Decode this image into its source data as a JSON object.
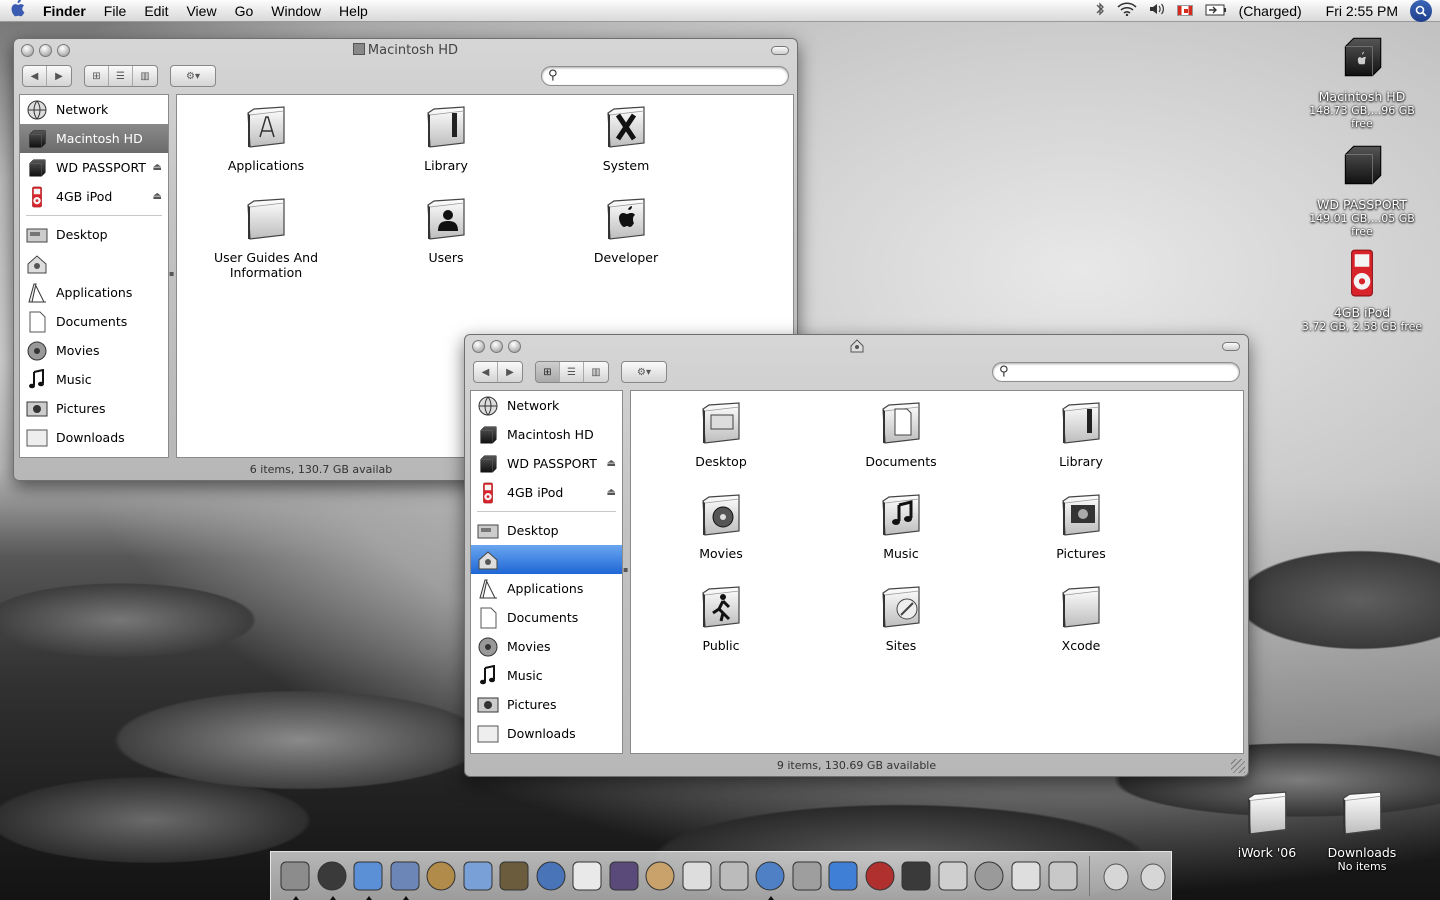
{
  "menubar": {
    "apple": "",
    "app_name": "Finder",
    "items": [
      "File",
      "Edit",
      "View",
      "Go",
      "Window",
      "Help"
    ],
    "battery_status": "(Charged)",
    "clock": "Fri 2:55 PM"
  },
  "window1": {
    "title": "Macintosh HD",
    "status": "6 items, 130.7 GB availab",
    "sidebar_devices": [
      {
        "label": "Network",
        "icon": "network-icon"
      },
      {
        "label": "Macintosh HD",
        "icon": "hard-drive-icon",
        "selected": true
      },
      {
        "label": "WD PASSPORT",
        "icon": "external-drive-icon",
        "eject": "⏏"
      },
      {
        "label": "4GB iPod",
        "icon": "ipod-icon",
        "eject": "⏏"
      }
    ],
    "sidebar_places": [
      {
        "label": "Desktop",
        "icon": "desktop-icon"
      },
      {
        "label": "",
        "icon": "home-icon"
      },
      {
        "label": "Applications",
        "icon": "applications-icon"
      },
      {
        "label": "Documents",
        "icon": "documents-icon"
      },
      {
        "label": "Movies",
        "icon": "movies-icon"
      },
      {
        "label": "Music",
        "icon": "music-icon"
      },
      {
        "label": "Pictures",
        "icon": "pictures-icon"
      },
      {
        "label": "Downloads",
        "icon": "downloads-icon"
      }
    ],
    "items": [
      {
        "label": "Applications",
        "icon": "applications-folder-icon"
      },
      {
        "label": "Library",
        "icon": "library-folder-icon"
      },
      {
        "label": "System",
        "icon": "system-folder-icon"
      },
      {
        "label": "User Guides And Information",
        "icon": "folder-icon"
      },
      {
        "label": "Users",
        "icon": "users-folder-icon"
      },
      {
        "label": "Developer",
        "icon": "developer-folder-icon"
      }
    ]
  },
  "window2": {
    "title": "",
    "status": "9 items, 130.69 GB available",
    "sidebar_devices": [
      {
        "label": "Network",
        "icon": "network-icon"
      },
      {
        "label": "Macintosh HD",
        "icon": "hard-drive-icon"
      },
      {
        "label": "WD PASSPORT",
        "icon": "external-drive-icon",
        "eject": "⏏"
      },
      {
        "label": "4GB iPod",
        "icon": "ipod-icon",
        "eject": "⏏"
      }
    ],
    "sidebar_places": [
      {
        "label": "Desktop",
        "icon": "desktop-icon"
      },
      {
        "label": "",
        "icon": "home-icon",
        "selected": true
      },
      {
        "label": "Applications",
        "icon": "applications-icon"
      },
      {
        "label": "Documents",
        "icon": "documents-icon"
      },
      {
        "label": "Movies",
        "icon": "movies-icon"
      },
      {
        "label": "Music",
        "icon": "music-icon"
      },
      {
        "label": "Pictures",
        "icon": "pictures-icon"
      },
      {
        "label": "Downloads",
        "icon": "downloads-icon"
      }
    ],
    "items": [
      {
        "label": "Desktop",
        "icon": "desktop-folder-icon"
      },
      {
        "label": "Documents",
        "icon": "documents-folder-icon"
      },
      {
        "label": "Library",
        "icon": "library-folder-icon"
      },
      {
        "label": "Movies",
        "icon": "movies-folder-icon"
      },
      {
        "label": "Music",
        "icon": "music-folder-icon"
      },
      {
        "label": "Pictures",
        "icon": "pictures-folder-icon"
      },
      {
        "label": "Public",
        "icon": "public-folder-icon"
      },
      {
        "label": "Sites",
        "icon": "sites-folder-icon"
      },
      {
        "label": "Xcode",
        "icon": "folder-icon"
      }
    ]
  },
  "desktop": {
    "macintosh_hd": {
      "label": "Macintosh HD",
      "sub": "148.73 GB,...96 GB free"
    },
    "wd_passport": {
      "label": "WD PASSPORT",
      "sub": "149.01 GB,...05 GB free"
    },
    "ipod": {
      "label": "4GB iPod",
      "sub": "3.72 GB, 2.58 GB free"
    },
    "iwork": {
      "label": "iWork '06"
    },
    "downloads": {
      "label": "Downloads",
      "sub": "No items"
    }
  },
  "dock": {
    "items": [
      "finder-icon",
      "dashboard-icon",
      "safari-icon",
      "mail-icon",
      "address-book-icon",
      "itunes-icon",
      "iphoto-icon",
      "imovie-icon",
      "ical-icon",
      "front-row-icon",
      "preview-icon",
      "textedit-icon",
      "dictionary-icon",
      "xcode-icon",
      "interface-builder-icon",
      "quicktime-icon",
      "photo-booth-icon",
      "chess-icon",
      "calculator-icon",
      "system-preferences-icon",
      "x11-icon",
      "network-utility-icon"
    ],
    "running": [
      0,
      1,
      2,
      3,
      13
    ],
    "right_items": [
      "mail-stack-icon",
      "trash-icon"
    ]
  },
  "colors": {
    "selection_blue": "#2a72dc",
    "selection_gray": "#7a7a7a",
    "ipod_red": "#d8232a"
  }
}
